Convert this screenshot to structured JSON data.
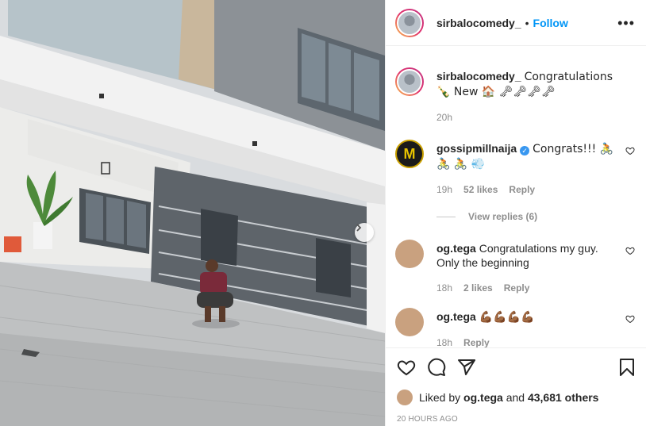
{
  "header": {
    "username": "sirbalocomedy_",
    "separator": "•",
    "follow_label": "Follow",
    "more_icon": "more-icon",
    "more_glyph": "•••"
  },
  "caption": {
    "username": "sirbalocomedy_",
    "text": "Congratulations 🍾 New 🏠 🗝🗝🗝🗝",
    "time": "20h"
  },
  "comments": [
    {
      "username": "gossipmillnaija",
      "verified": true,
      "text": "Congrats!!! 🚴 🚴 🚴 💨",
      "time": "19h",
      "likes": "52 likes",
      "reply": "Reply",
      "avatar_letter": "M",
      "view_replies": "View replies (6)"
    },
    {
      "username": "og.tega",
      "verified": false,
      "text": "Congratulations my guy. Only the beginning",
      "time": "18h",
      "likes": "2 likes",
      "reply": "Reply"
    },
    {
      "username": "og.tega",
      "verified": false,
      "text": "💪🏾💪🏾💪🏾💪🏾",
      "time": "18h",
      "reply": "Reply"
    }
  ],
  "actions": {
    "icons": [
      "heart-icon",
      "comment-icon",
      "share-icon",
      "bookmark-icon"
    ]
  },
  "likes_summary": {
    "prefix": "Liked by",
    "user": "og.tega",
    "middle": "and",
    "others": "43,681 others"
  },
  "timestamp": "20 HOURS AGO",
  "colors": {
    "accent": "#0095f6",
    "text": "#262626",
    "muted": "#8e8e8e",
    "verified": "#3897f0"
  }
}
